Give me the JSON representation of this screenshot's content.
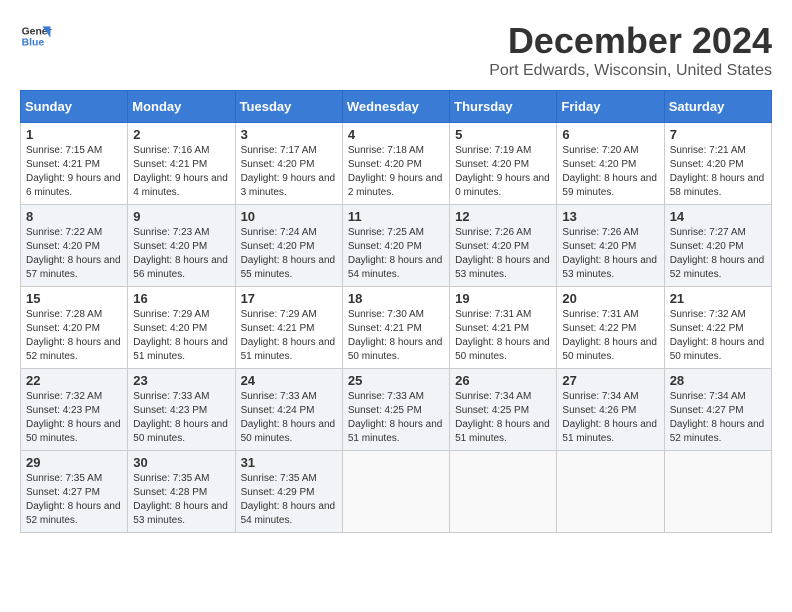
{
  "header": {
    "logo_line1": "General",
    "logo_line2": "Blue",
    "month": "December 2024",
    "location": "Port Edwards, Wisconsin, United States"
  },
  "weekdays": [
    "Sunday",
    "Monday",
    "Tuesday",
    "Wednesday",
    "Thursday",
    "Friday",
    "Saturday"
  ],
  "weeks": [
    [
      {
        "day": "1",
        "sunrise": "Sunrise: 7:15 AM",
        "sunset": "Sunset: 4:21 PM",
        "daylight": "Daylight: 9 hours and 6 minutes."
      },
      {
        "day": "2",
        "sunrise": "Sunrise: 7:16 AM",
        "sunset": "Sunset: 4:21 PM",
        "daylight": "Daylight: 9 hours and 4 minutes."
      },
      {
        "day": "3",
        "sunrise": "Sunrise: 7:17 AM",
        "sunset": "Sunset: 4:20 PM",
        "daylight": "Daylight: 9 hours and 3 minutes."
      },
      {
        "day": "4",
        "sunrise": "Sunrise: 7:18 AM",
        "sunset": "Sunset: 4:20 PM",
        "daylight": "Daylight: 9 hours and 2 minutes."
      },
      {
        "day": "5",
        "sunrise": "Sunrise: 7:19 AM",
        "sunset": "Sunset: 4:20 PM",
        "daylight": "Daylight: 9 hours and 0 minutes."
      },
      {
        "day": "6",
        "sunrise": "Sunrise: 7:20 AM",
        "sunset": "Sunset: 4:20 PM",
        "daylight": "Daylight: 8 hours and 59 minutes."
      },
      {
        "day": "7",
        "sunrise": "Sunrise: 7:21 AM",
        "sunset": "Sunset: 4:20 PM",
        "daylight": "Daylight: 8 hours and 58 minutes."
      }
    ],
    [
      {
        "day": "8",
        "sunrise": "Sunrise: 7:22 AM",
        "sunset": "Sunset: 4:20 PM",
        "daylight": "Daylight: 8 hours and 57 minutes."
      },
      {
        "day": "9",
        "sunrise": "Sunrise: 7:23 AM",
        "sunset": "Sunset: 4:20 PM",
        "daylight": "Daylight: 8 hours and 56 minutes."
      },
      {
        "day": "10",
        "sunrise": "Sunrise: 7:24 AM",
        "sunset": "Sunset: 4:20 PM",
        "daylight": "Daylight: 8 hours and 55 minutes."
      },
      {
        "day": "11",
        "sunrise": "Sunrise: 7:25 AM",
        "sunset": "Sunset: 4:20 PM",
        "daylight": "Daylight: 8 hours and 54 minutes."
      },
      {
        "day": "12",
        "sunrise": "Sunrise: 7:26 AM",
        "sunset": "Sunset: 4:20 PM",
        "daylight": "Daylight: 8 hours and 53 minutes."
      },
      {
        "day": "13",
        "sunrise": "Sunrise: 7:26 AM",
        "sunset": "Sunset: 4:20 PM",
        "daylight": "Daylight: 8 hours and 53 minutes."
      },
      {
        "day": "14",
        "sunrise": "Sunrise: 7:27 AM",
        "sunset": "Sunset: 4:20 PM",
        "daylight": "Daylight: 8 hours and 52 minutes."
      }
    ],
    [
      {
        "day": "15",
        "sunrise": "Sunrise: 7:28 AM",
        "sunset": "Sunset: 4:20 PM",
        "daylight": "Daylight: 8 hours and 52 minutes."
      },
      {
        "day": "16",
        "sunrise": "Sunrise: 7:29 AM",
        "sunset": "Sunset: 4:20 PM",
        "daylight": "Daylight: 8 hours and 51 minutes."
      },
      {
        "day": "17",
        "sunrise": "Sunrise: 7:29 AM",
        "sunset": "Sunset: 4:21 PM",
        "daylight": "Daylight: 8 hours and 51 minutes."
      },
      {
        "day": "18",
        "sunrise": "Sunrise: 7:30 AM",
        "sunset": "Sunset: 4:21 PM",
        "daylight": "Daylight: 8 hours and 50 minutes."
      },
      {
        "day": "19",
        "sunrise": "Sunrise: 7:31 AM",
        "sunset": "Sunset: 4:21 PM",
        "daylight": "Daylight: 8 hours and 50 minutes."
      },
      {
        "day": "20",
        "sunrise": "Sunrise: 7:31 AM",
        "sunset": "Sunset: 4:22 PM",
        "daylight": "Daylight: 8 hours and 50 minutes."
      },
      {
        "day": "21",
        "sunrise": "Sunrise: 7:32 AM",
        "sunset": "Sunset: 4:22 PM",
        "daylight": "Daylight: 8 hours and 50 minutes."
      }
    ],
    [
      {
        "day": "22",
        "sunrise": "Sunrise: 7:32 AM",
        "sunset": "Sunset: 4:23 PM",
        "daylight": "Daylight: 8 hours and 50 minutes."
      },
      {
        "day": "23",
        "sunrise": "Sunrise: 7:33 AM",
        "sunset": "Sunset: 4:23 PM",
        "daylight": "Daylight: 8 hours and 50 minutes."
      },
      {
        "day": "24",
        "sunrise": "Sunrise: 7:33 AM",
        "sunset": "Sunset: 4:24 PM",
        "daylight": "Daylight: 8 hours and 50 minutes."
      },
      {
        "day": "25",
        "sunrise": "Sunrise: 7:33 AM",
        "sunset": "Sunset: 4:25 PM",
        "daylight": "Daylight: 8 hours and 51 minutes."
      },
      {
        "day": "26",
        "sunrise": "Sunrise: 7:34 AM",
        "sunset": "Sunset: 4:25 PM",
        "daylight": "Daylight: 8 hours and 51 minutes."
      },
      {
        "day": "27",
        "sunrise": "Sunrise: 7:34 AM",
        "sunset": "Sunset: 4:26 PM",
        "daylight": "Daylight: 8 hours and 51 minutes."
      },
      {
        "day": "28",
        "sunrise": "Sunrise: 7:34 AM",
        "sunset": "Sunset: 4:27 PM",
        "daylight": "Daylight: 8 hours and 52 minutes."
      }
    ],
    [
      {
        "day": "29",
        "sunrise": "Sunrise: 7:35 AM",
        "sunset": "Sunset: 4:27 PM",
        "daylight": "Daylight: 8 hours and 52 minutes."
      },
      {
        "day": "30",
        "sunrise": "Sunrise: 7:35 AM",
        "sunset": "Sunset: 4:28 PM",
        "daylight": "Daylight: 8 hours and 53 minutes."
      },
      {
        "day": "31",
        "sunrise": "Sunrise: 7:35 AM",
        "sunset": "Sunset: 4:29 PM",
        "daylight": "Daylight: 8 hours and 54 minutes."
      },
      null,
      null,
      null,
      null
    ]
  ]
}
